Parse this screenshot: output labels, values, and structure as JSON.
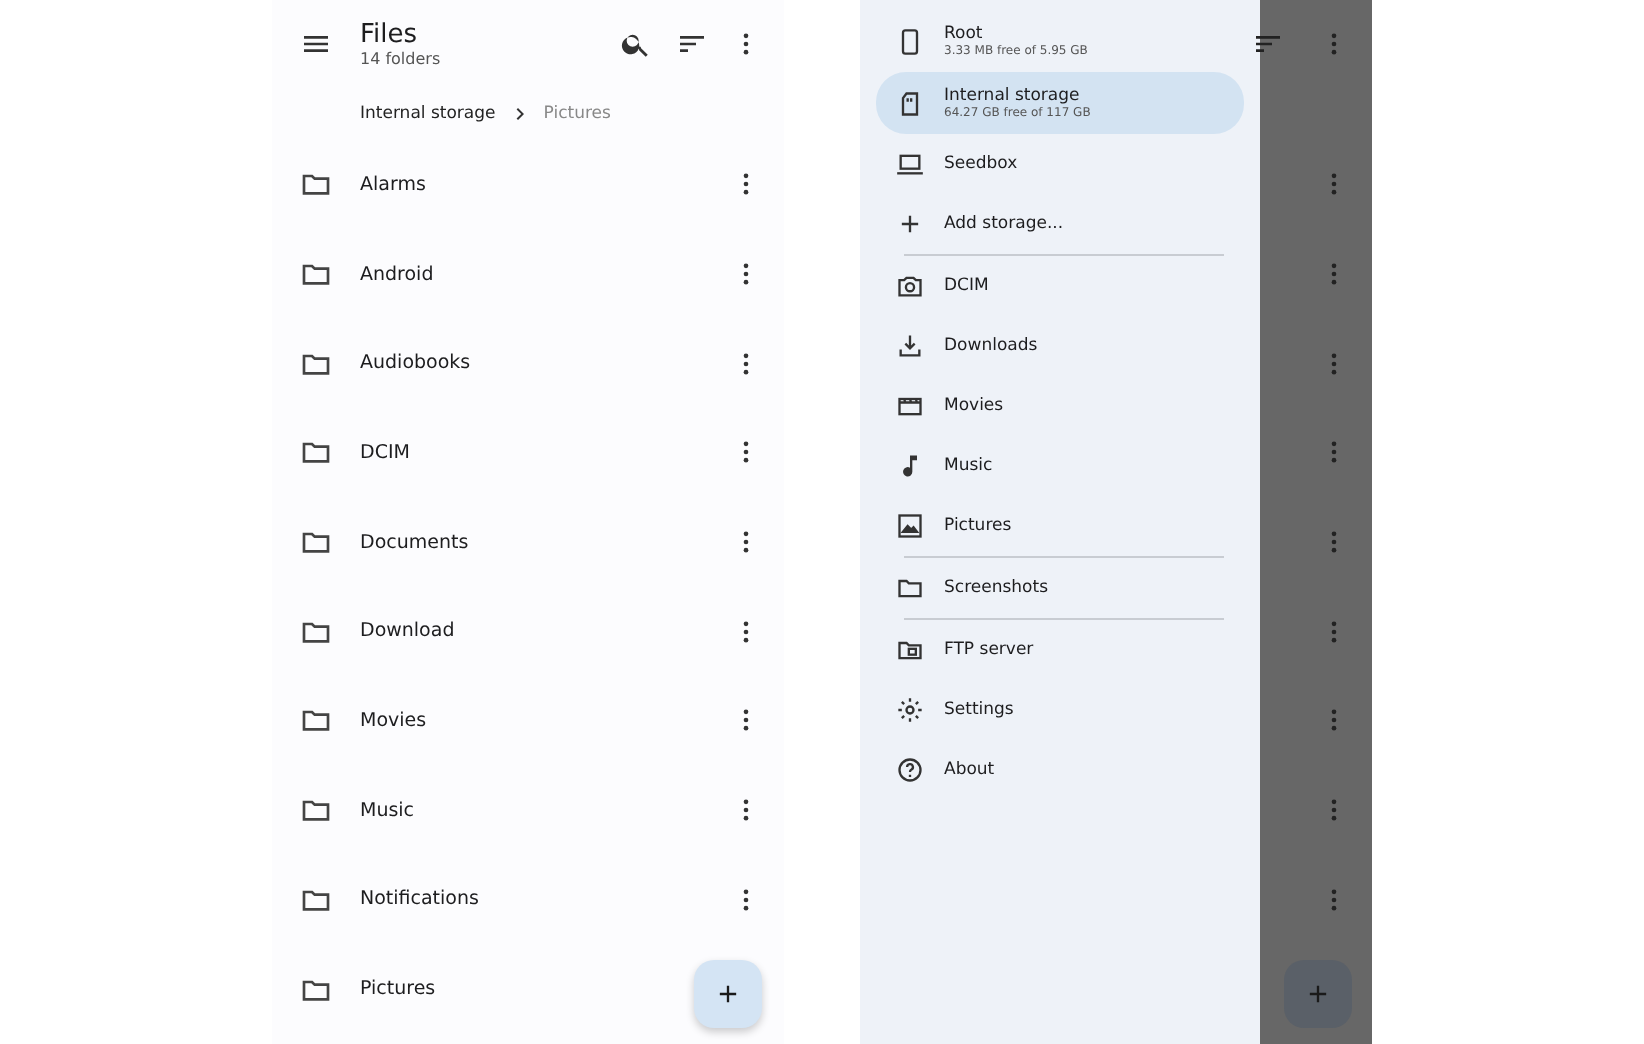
{
  "files_screen": {
    "app_bar": {
      "title": "Files",
      "subtitle": "14 folders"
    },
    "breadcrumb": [
      {
        "label": "Internal storage",
        "selected": true
      },
      {
        "label": "Pictures",
        "selected": false
      }
    ],
    "folders": [
      {
        "name": "Alarms"
      },
      {
        "name": "Android"
      },
      {
        "name": "Audiobooks"
      },
      {
        "name": "DCIM"
      },
      {
        "name": "Documents"
      },
      {
        "name": "Download"
      },
      {
        "name": "Movies"
      },
      {
        "name": "Music"
      },
      {
        "name": "Notifications"
      },
      {
        "name": "Pictures"
      }
    ]
  },
  "drawer_screen": {
    "drawer": {
      "items": [
        {
          "kind": "storage",
          "label": "Root",
          "detail": "3.33 MB free of 5.95 GB",
          "selected": false
        },
        {
          "kind": "storage",
          "label": "Internal storage",
          "detail": "64.27 GB free of 117 GB",
          "selected": true
        },
        {
          "kind": "item",
          "label": "Seedbox",
          "selected": false
        },
        {
          "kind": "item",
          "label": "Add storage...",
          "selected": false
        },
        {
          "kind": "divider"
        },
        {
          "kind": "item",
          "label": "DCIM",
          "selected": false
        },
        {
          "kind": "item",
          "label": "Downloads",
          "selected": false
        },
        {
          "kind": "item",
          "label": "Movies",
          "selected": false
        },
        {
          "kind": "item",
          "label": "Music",
          "selected": false
        },
        {
          "kind": "item",
          "label": "Pictures",
          "selected": false
        },
        {
          "kind": "divider"
        },
        {
          "kind": "item",
          "label": "Screenshots",
          "selected": false
        },
        {
          "kind": "divider"
        },
        {
          "kind": "item",
          "label": "FTP server",
          "selected": false
        },
        {
          "kind": "item",
          "label": "Settings",
          "selected": false
        },
        {
          "kind": "item",
          "label": "About",
          "selected": false
        }
      ]
    }
  }
}
